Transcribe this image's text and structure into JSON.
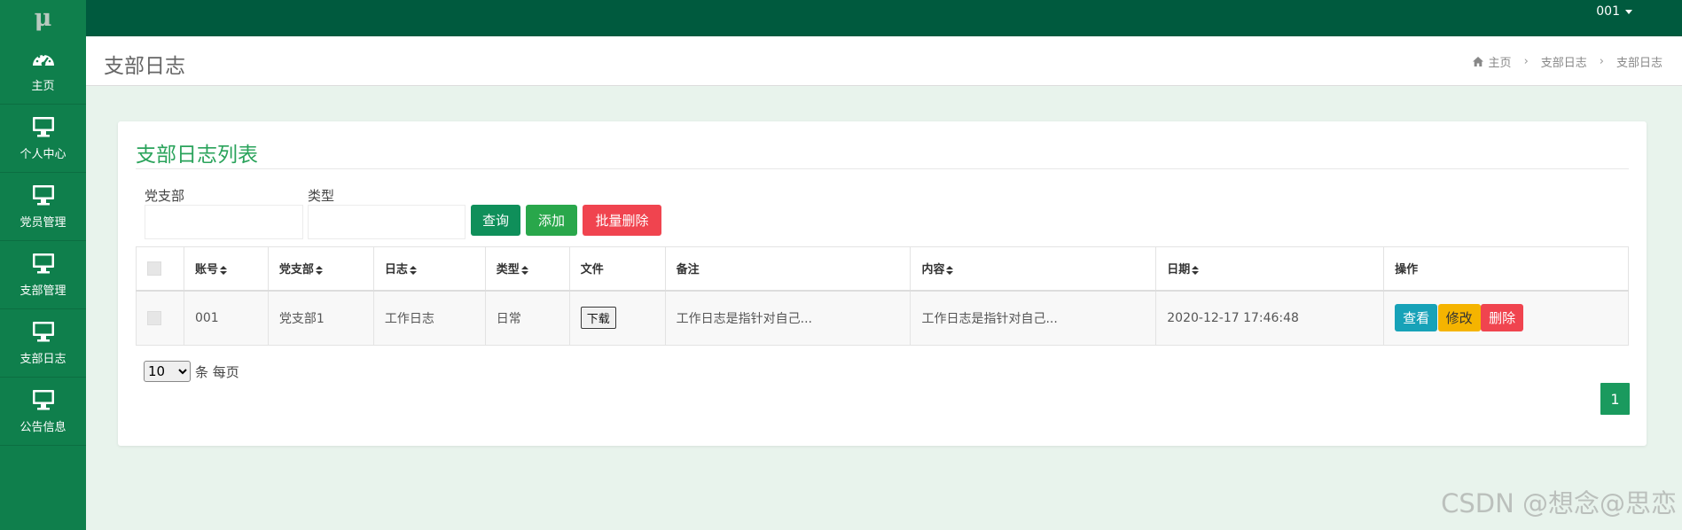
{
  "logo": "μ",
  "user": {
    "name": "001"
  },
  "sidebar": {
    "items": [
      {
        "label": "主页",
        "icon": "dashboard-icon"
      },
      {
        "label": "个人中心",
        "icon": "monitor-icon"
      },
      {
        "label": "党员管理",
        "icon": "monitor-icon"
      },
      {
        "label": "支部管理",
        "icon": "monitor-icon"
      },
      {
        "label": "支部日志",
        "icon": "monitor-icon"
      },
      {
        "label": "公告信息",
        "icon": "monitor-icon"
      }
    ]
  },
  "header": {
    "title": "支部日志",
    "breadcrumb": [
      "主页",
      "支部日志",
      "支部日志"
    ]
  },
  "panel": {
    "title": "支部日志列表",
    "filters": {
      "branch_label": "党支部",
      "branch_value": "",
      "type_label": "类型",
      "type_value": ""
    },
    "buttons": {
      "query": "查询",
      "add": "添加",
      "batch_delete": "批量删除"
    }
  },
  "table": {
    "columns": [
      "账号",
      "党支部",
      "日志",
      "类型",
      "文件",
      "备注",
      "内容",
      "日期",
      "操作"
    ],
    "rows": [
      {
        "account": "001",
        "branch": "党支部1",
        "log": "工作日志",
        "type": "日常",
        "file_button": "下载",
        "remark": "工作日志是指针对自己...",
        "content": "工作日志是指针对自己...",
        "date": "2020-12-17 17:46:48",
        "actions": {
          "view": "查看",
          "edit": "修改",
          "delete": "删除"
        }
      }
    ]
  },
  "pagination": {
    "page_size": "10",
    "page_size_options": [
      "10"
    ],
    "per_page_suffix": "条 每页",
    "current_page": "1"
  },
  "watermark": "CSDN @想念@思恋",
  "colors": {
    "sidebar": "#0f7f4c",
    "topbar": "#005a3e",
    "accent": "#2aa35b",
    "danger": "#f0444f",
    "info": "#17a2b8",
    "warning": "#f5b400"
  }
}
